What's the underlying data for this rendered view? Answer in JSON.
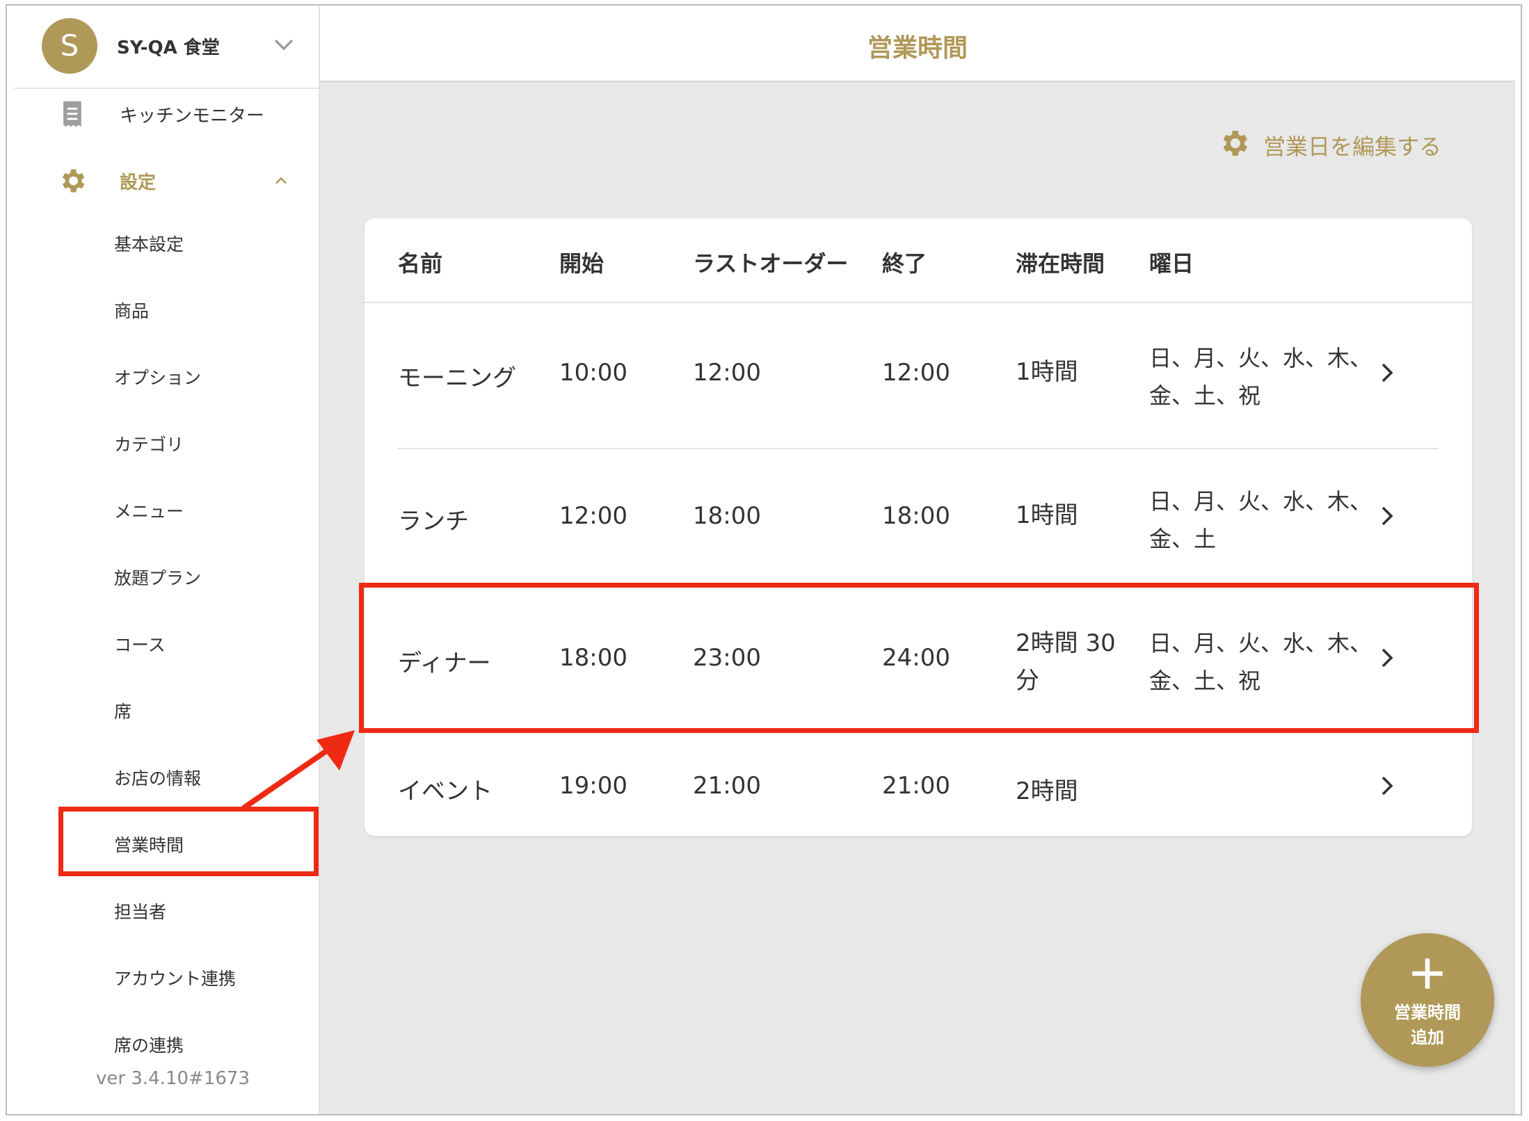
{
  "shop": {
    "initial": "S",
    "name": "SY-QA 食堂"
  },
  "nav": {
    "kitchen_monitor": "キッチンモニター",
    "settings": "設定"
  },
  "submenu": [
    "基本設定",
    "商品",
    "オプション",
    "カテゴリ",
    "メニュー",
    "放題プラン",
    "コース",
    "席",
    "お店の情報",
    "営業時間",
    "担当者",
    "アカウント連携",
    "席の連携"
  ],
  "version": "ver 3.4.10#1673",
  "header": {
    "title": "営業時間"
  },
  "edit_days": "営業日を編集する",
  "table": {
    "columns": [
      "名前",
      "開始",
      "ラストオーダー",
      "終了",
      "滞在時間",
      "曜日"
    ],
    "rows": [
      {
        "name": "モーニング",
        "start": "10:00",
        "last_order": "12:00",
        "end": "12:00",
        "stay": "1時間",
        "days": "日、月、火、水、木、金、土、祝"
      },
      {
        "name": "ランチ",
        "start": "12:00",
        "last_order": "18:00",
        "end": "18:00",
        "stay": "1時間",
        "days": "日、月、火、水、木、金、土"
      },
      {
        "name": "ディナー",
        "start": "18:00",
        "last_order": "23:00",
        "end": "24:00",
        "stay": "2時間 30分",
        "days": "日、月、火、水、木、金、土、祝"
      },
      {
        "name": "イベント",
        "start": "19:00",
        "last_order": "21:00",
        "end": "21:00",
        "stay": "2時間",
        "days": ""
      }
    ]
  },
  "fab": {
    "line1": "営業時間",
    "line2": "追加"
  },
  "colors": {
    "accent": "#b09858",
    "highlight": "#ee2a14",
    "background": "#e8e8e8"
  }
}
